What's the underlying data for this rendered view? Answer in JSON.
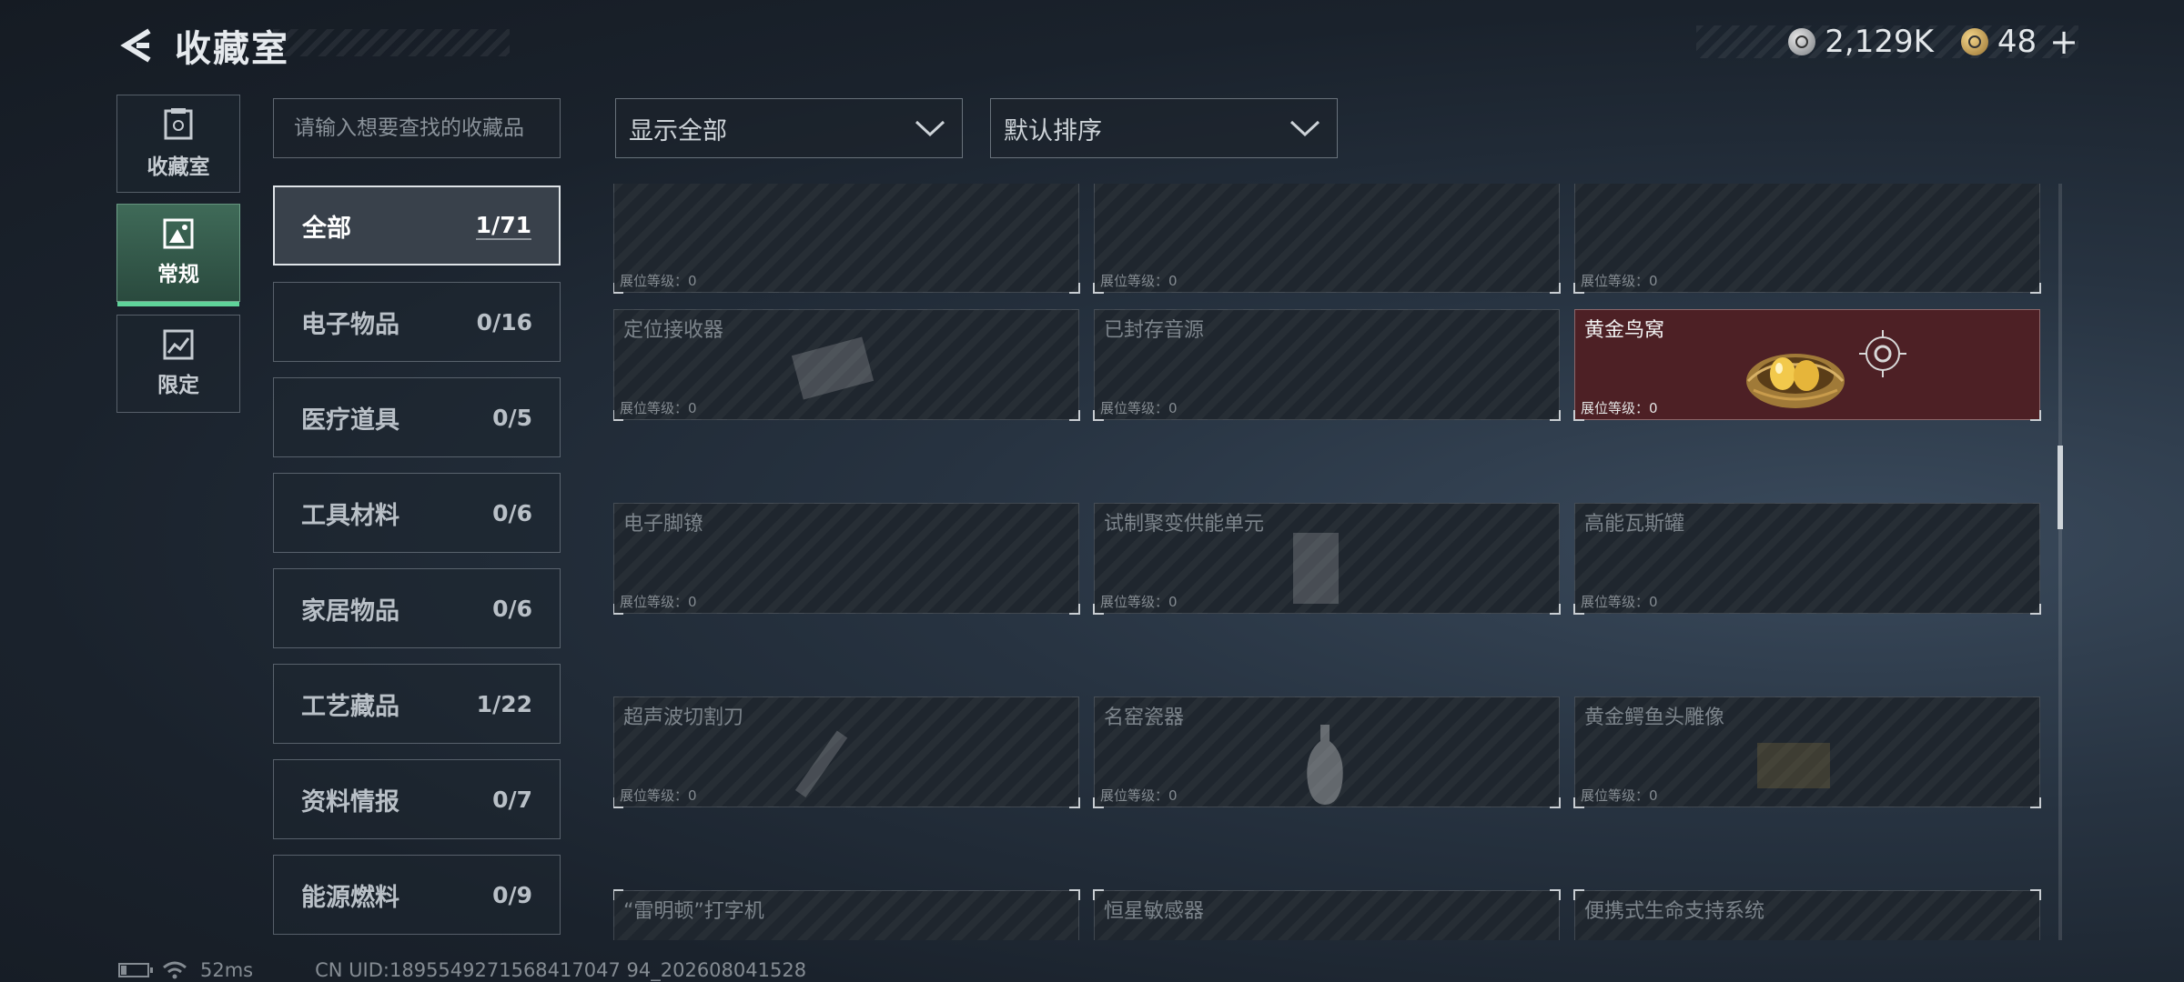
{
  "header": {
    "title": "收藏室"
  },
  "currency": {
    "silver_amount": "2,129K",
    "gold_amount": "48",
    "plus": "+"
  },
  "nav": [
    {
      "label": "收藏室",
      "icon": "archive-icon",
      "active": false
    },
    {
      "label": "常规",
      "icon": "image-frame-icon",
      "active": true
    },
    {
      "label": "限定",
      "icon": "limited-frame-icon",
      "active": false
    }
  ],
  "search": {
    "placeholder": "请输入想要查找的收藏品",
    "value": ""
  },
  "filters": {
    "show": "显示全部",
    "sort": "默认排序"
  },
  "categories": [
    {
      "label": "全部",
      "count": "1/71",
      "active": true
    },
    {
      "label": "电子物品",
      "count": "0/16"
    },
    {
      "label": "医疗道具",
      "count": "0/5"
    },
    {
      "label": "工具材料",
      "count": "0/6"
    },
    {
      "label": "家居物品",
      "count": "0/6"
    },
    {
      "label": "工艺藏品",
      "count": "1/22"
    },
    {
      "label": "资料情报",
      "count": "0/7"
    },
    {
      "label": "能源燃料",
      "count": "0/9"
    }
  ],
  "level_label": "展位等级：0",
  "items": [
    {
      "name": "",
      "owned": false
    },
    {
      "name": "",
      "owned": false
    },
    {
      "name": "",
      "owned": false
    },
    {
      "name": "定位接收器",
      "owned": false
    },
    {
      "name": "已封存音源",
      "owned": false
    },
    {
      "name": "黄金鸟窝",
      "owned": true
    },
    {
      "name": "电子脚镣",
      "owned": false
    },
    {
      "name": "试制聚变供能单元",
      "owned": false
    },
    {
      "name": "高能瓦斯罐",
      "owned": false
    },
    {
      "name": "超声波切割刀",
      "owned": false
    },
    {
      "name": "名窑瓷器",
      "owned": false
    },
    {
      "name": "黄金鳄鱼头雕像",
      "owned": false
    },
    {
      "name": "“雷明顿”打字机",
      "owned": false
    },
    {
      "name": "恒星敏感器",
      "owned": false
    },
    {
      "name": "便携式生命支持系统",
      "owned": false
    }
  ],
  "footer": {
    "ping": "52ms",
    "uid": "CN UID:1895549271568417047 94_202608041528"
  },
  "colors": {
    "accent_green": "#5fd39a",
    "owned_bg": "#4d2025"
  }
}
